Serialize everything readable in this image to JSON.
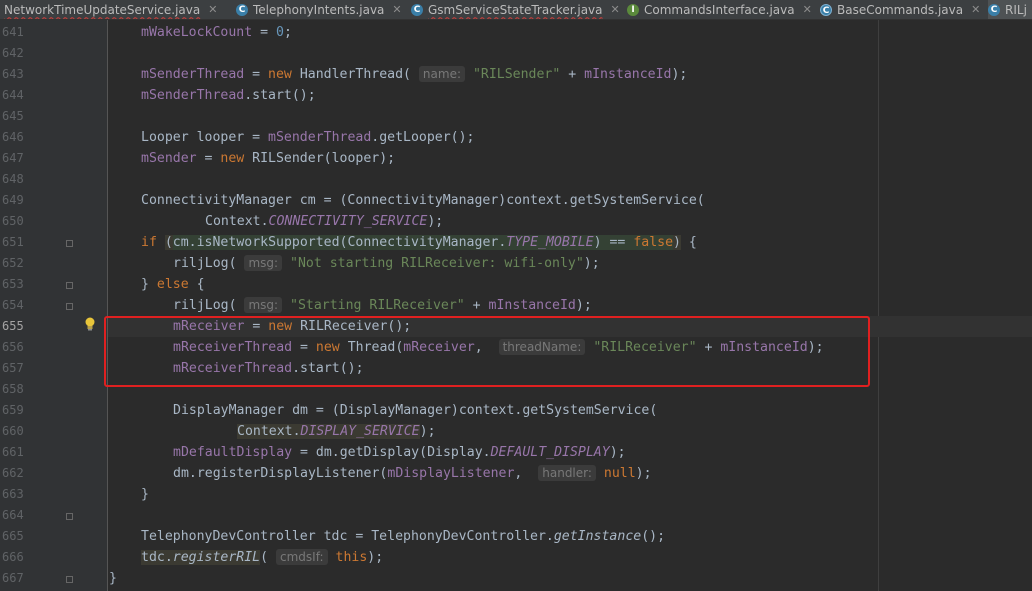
{
  "tabs": [
    {
      "label": "NetworkTimeUpdateService.java",
      "icon": "class-icon"
    },
    {
      "label": "TelephonyIntents.java",
      "icon": "class-icon"
    },
    {
      "label": "GsmServiceStateTracker.java",
      "icon": "class-icon"
    },
    {
      "label": "CommandsInterface.java",
      "icon": "interface-icon"
    },
    {
      "label": "BaseCommands.java",
      "icon": "abstract-class-icon"
    },
    {
      "label": "RILj",
      "icon": "class-icon"
    }
  ],
  "line_numbers": [
    "641",
    "642",
    "643",
    "644",
    "645",
    "646",
    "647",
    "648",
    "649",
    "650",
    "651",
    "652",
    "653",
    "654",
    "655",
    "656",
    "657",
    "658",
    "659",
    "660",
    "661",
    "662",
    "663",
    "664",
    "665",
    "666",
    "667"
  ],
  "current_line": "655",
  "hints": {
    "name": "name:",
    "msg1": "msg:",
    "msg2": "msg:",
    "threadName": "threadName:",
    "handler": "handler:",
    "cmdsIf": "cmdsIf:"
  },
  "colors": {
    "background": "#2b2b2b",
    "keyword": "#cc7832",
    "string": "#6a8759",
    "field": "#9876aa",
    "number": "#6897bb",
    "highlight_box": "#e02020"
  }
}
